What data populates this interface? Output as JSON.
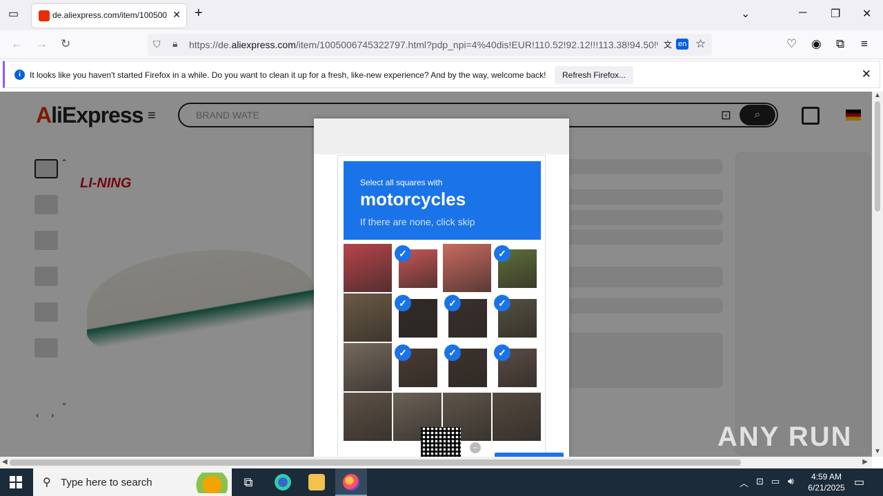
{
  "browser": {
    "tab_title": "de.aliexpress.com/item/100500",
    "tab_close": "✕",
    "new_tab": "+",
    "url_domain_prefix": "https://de.",
    "url_domain": "aliexpress.com",
    "url_rest": "/item/1005006745322797.html?pdp_npi=4%40dis!EUR!110.52!92.12!!!113.38!94.50!%4",
    "translate_lang": "en",
    "window_min": "─",
    "window_max": "❐",
    "window_close": "✕",
    "list_tabs": "⌄"
  },
  "notice": {
    "message": "It looks like you haven't started Firefox in a while. Do you want to clean it up for a fresh, like-new experience? And by the way, welcome back!",
    "button_label": "Refresh Firefox...",
    "info_glyph": "i",
    "close_glyph": "✕"
  },
  "page": {
    "logo_text": "liExpress",
    "logo_letter": "A",
    "menu_glyph": "≡",
    "search_placeholder": "BRAND WATE",
    "search_glyph": "⌕",
    "brand": "LI-NING"
  },
  "captcha": {
    "instruction_small": "Select all squares with",
    "target": "motorcycles",
    "hint": "If there are none, click skip",
    "check_glyph": "✓",
    "help_glyph": "−",
    "tiles": [
      {
        "selected": false,
        "color": "#b8434a"
      },
      {
        "selected": true,
        "color": "#c65555"
      },
      {
        "selected": false,
        "color": "#c96a5f"
      },
      {
        "selected": true,
        "color": "#5e6e3a"
      },
      {
        "selected": false,
        "color": "#6b5a45"
      },
      {
        "selected": true,
        "color": "#2f2a28"
      },
      {
        "selected": true,
        "color": "#3a2f2c"
      },
      {
        "selected": true,
        "color": "#54503f"
      },
      {
        "selected": false,
        "color": "#75695c"
      },
      {
        "selected": true,
        "color": "#4a3b33"
      },
      {
        "selected": true,
        "color": "#3b322c"
      },
      {
        "selected": true,
        "color": "#5a4c44"
      },
      {
        "selected": false,
        "color": "#5e5146"
      },
      {
        "selected": false,
        "color": "#6b6156"
      },
      {
        "selected": false,
        "color": "#5f5549"
      },
      {
        "selected": false,
        "color": "#54493f"
      }
    ]
  },
  "watermark": "ANY RUN",
  "taskbar": {
    "search_label": "Type here to search",
    "search_glyph": "⚲",
    "time": "4:59 AM",
    "date": "6/21/2025"
  }
}
